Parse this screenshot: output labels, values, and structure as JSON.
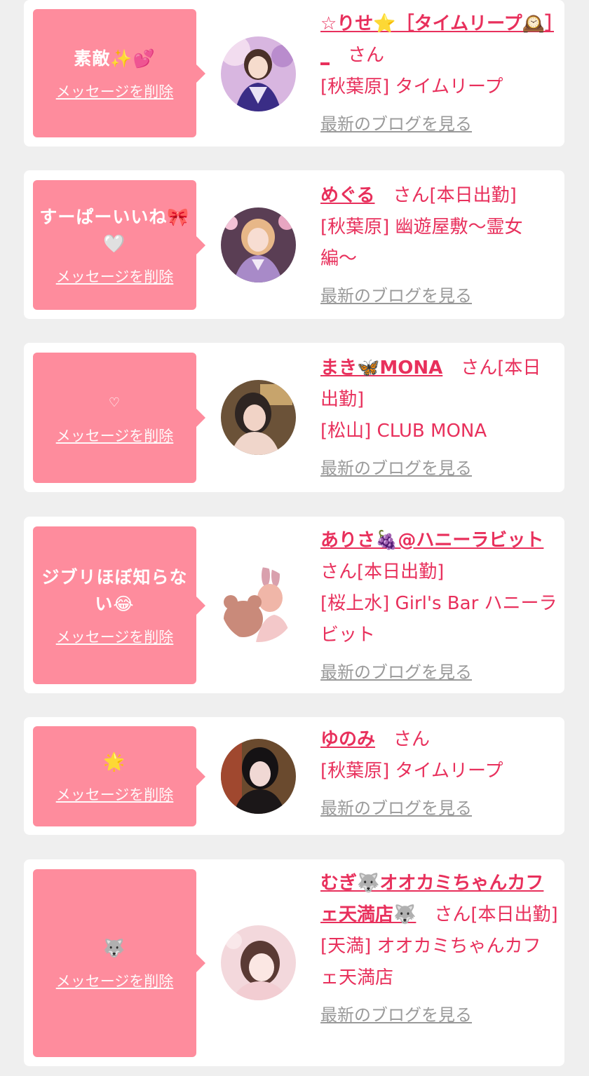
{
  "delete_label": "メッセージを削除",
  "blog_label": "最新のブログを見る",
  "san_label": "さん",
  "cards": [
    {
      "message": "素敵✨💕",
      "name": "☆りせ⭐️［タイムリープ🕰️］_",
      "suffix": "",
      "shop": "[秋葉原] タイムリープ"
    },
    {
      "message": "すーぱーいいね🎀🤍",
      "name": "めぐる",
      "suffix": "[本日出勤]",
      "shop": "[秋葉原] 幽遊屋敷〜霊女編〜"
    },
    {
      "message": "♡",
      "name": "まき🦋MONA",
      "suffix": "[本日出勤]",
      "shop": "[松山] CLUB MONA"
    },
    {
      "message": "ジブリほぼ知らない😂",
      "name": "ありさ🍇@ハニーラビット",
      "suffix": "[本日出勤]",
      "shop": "[桜上水] Girl's Bar ハニーラビット"
    },
    {
      "message": "🌟",
      "name": "ゆのみ",
      "suffix": "",
      "shop": "[秋葉原] タイムリープ"
    },
    {
      "message": "🐺",
      "name": "むぎ🐺オオカミちゃんカフェ天満店🐺",
      "suffix": "[本日出勤]",
      "shop": "[天満] オオカミちゃんカフェ天満店"
    }
  ],
  "colors": {
    "background": "#efefef",
    "bubble": "#fe8c9d",
    "accent": "#e8305c",
    "blog_link": "#9a9a9a"
  }
}
